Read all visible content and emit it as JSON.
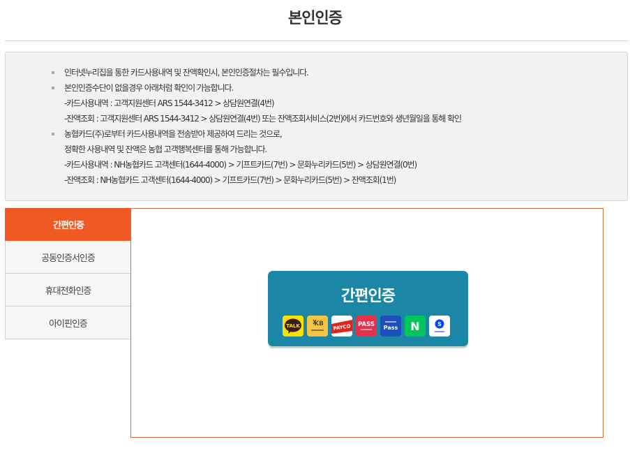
{
  "header": {
    "title": "본인인증"
  },
  "notice": {
    "lines": [
      "인터넷누리집을 통한 카드사용내역 및 잔액확인시, 본인인증절차는 필수입니다.",
      "본인인증수단이 없을경우 아래처럼 확인이 가능합니다.",
      "-카드사용내역 : 고객지원센터 ARS 1544-3412 > 상담원연결(4번)",
      "-잔액조회 : 고객지원센터 ARS 1544-3412 > 상담원연결(4번) 또는 잔액조회서비스(2번)에서 카드번호와 생년월일을 통해 확인",
      "농협카드(주)로부터 카드사용내역을 전송받아 제공하여 드리는 것으로,",
      "정확한 사용내역 및 잔액은 농협 고객행복센터를 통해 가능합니다.",
      "-카드사용내역 : NH농협카드 고객센터(1644-4000) > 기프트카드(7번) > 문화누리카드(5번) > 상담원연결(0번)",
      "-잔액조회 : NH농협카드 고객센터(1644-4000) > 기프트카드(7번) > 문화누리카드(5번) > 잔액조회(1번)"
    ]
  },
  "tabs": [
    {
      "label": "간편인증",
      "active": true
    },
    {
      "label": "공동인증서인증",
      "active": false
    },
    {
      "label": "휴대전화인증",
      "active": false
    },
    {
      "label": "아이핀인증",
      "active": false
    }
  ],
  "simple_auth": {
    "title": "간편인증",
    "providers": [
      {
        "icon": "kakao-talk-icon",
        "label": "TALK",
        "bg": "#fae100",
        "fg": "#3c1e1e"
      },
      {
        "icon": "kb-bank-icon",
        "label": "KB",
        "bg": "#f6c343",
        "fg": "#5a4a2a"
      },
      {
        "icon": "payco-icon",
        "label": "PAYCO",
        "bg": "#ffffff",
        "fg": "#e2231a"
      },
      {
        "icon": "pass-icon",
        "label": "PASS",
        "bg": "#e6304a",
        "fg": "#ffffff"
      },
      {
        "icon": "samsung-pass-icon",
        "label": "Pass",
        "bg": "#1f4fbf",
        "fg": "#ffffff"
      },
      {
        "icon": "naver-icon",
        "label": "N",
        "bg": "#03c75a",
        "fg": "#ffffff"
      },
      {
        "icon": "shinhan-bank-icon",
        "label": "S",
        "bg": "#ffffff",
        "fg": "#0046ff"
      }
    ]
  }
}
